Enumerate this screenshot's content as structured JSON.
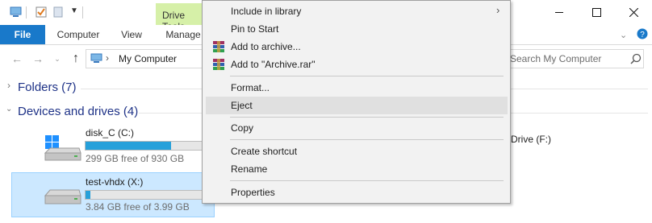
{
  "ribbon": {
    "tabs": [
      "File",
      "Computer",
      "View",
      "Manage"
    ],
    "contextual_group": "Drive Tools"
  },
  "address": {
    "location": "My Computer",
    "search_placeholder": "Search My Computer"
  },
  "groups": {
    "folders": "Folders (7)",
    "devices": "Devices and drives (4)"
  },
  "drives": [
    {
      "name": "disk_C (C:)",
      "free_text": "299 GB free of 930 GB",
      "used_fraction": 0.68
    },
    {
      "name": "test-vhdx (X:)",
      "free_text": "3.84 GB free of 3.99 GB",
      "used_fraction": 0.04
    }
  ],
  "partial_drive_label": "Drive (F:)",
  "context_menu": {
    "items": [
      {
        "label": "Include in library",
        "submenu": true
      },
      {
        "label": "Pin to Start"
      },
      {
        "label": "Add to archive...",
        "icon": "winrar-icon"
      },
      {
        "label": "Add to \"Archive.rar\"",
        "icon": "winrar-icon"
      },
      {
        "label": "Format..."
      },
      {
        "label": "Eject",
        "highlighted": true
      },
      {
        "label": "Copy"
      },
      {
        "label": "Create shortcut"
      },
      {
        "label": "Rename"
      },
      {
        "label": "Properties"
      }
    ]
  },
  "colors": {
    "accent": "#1979ca",
    "bar_fill": "#26a0da",
    "selection_bg": "#cce8ff",
    "drive_tools_bg": "#d6f0a8",
    "menu_bg": "#f2f2f2"
  }
}
